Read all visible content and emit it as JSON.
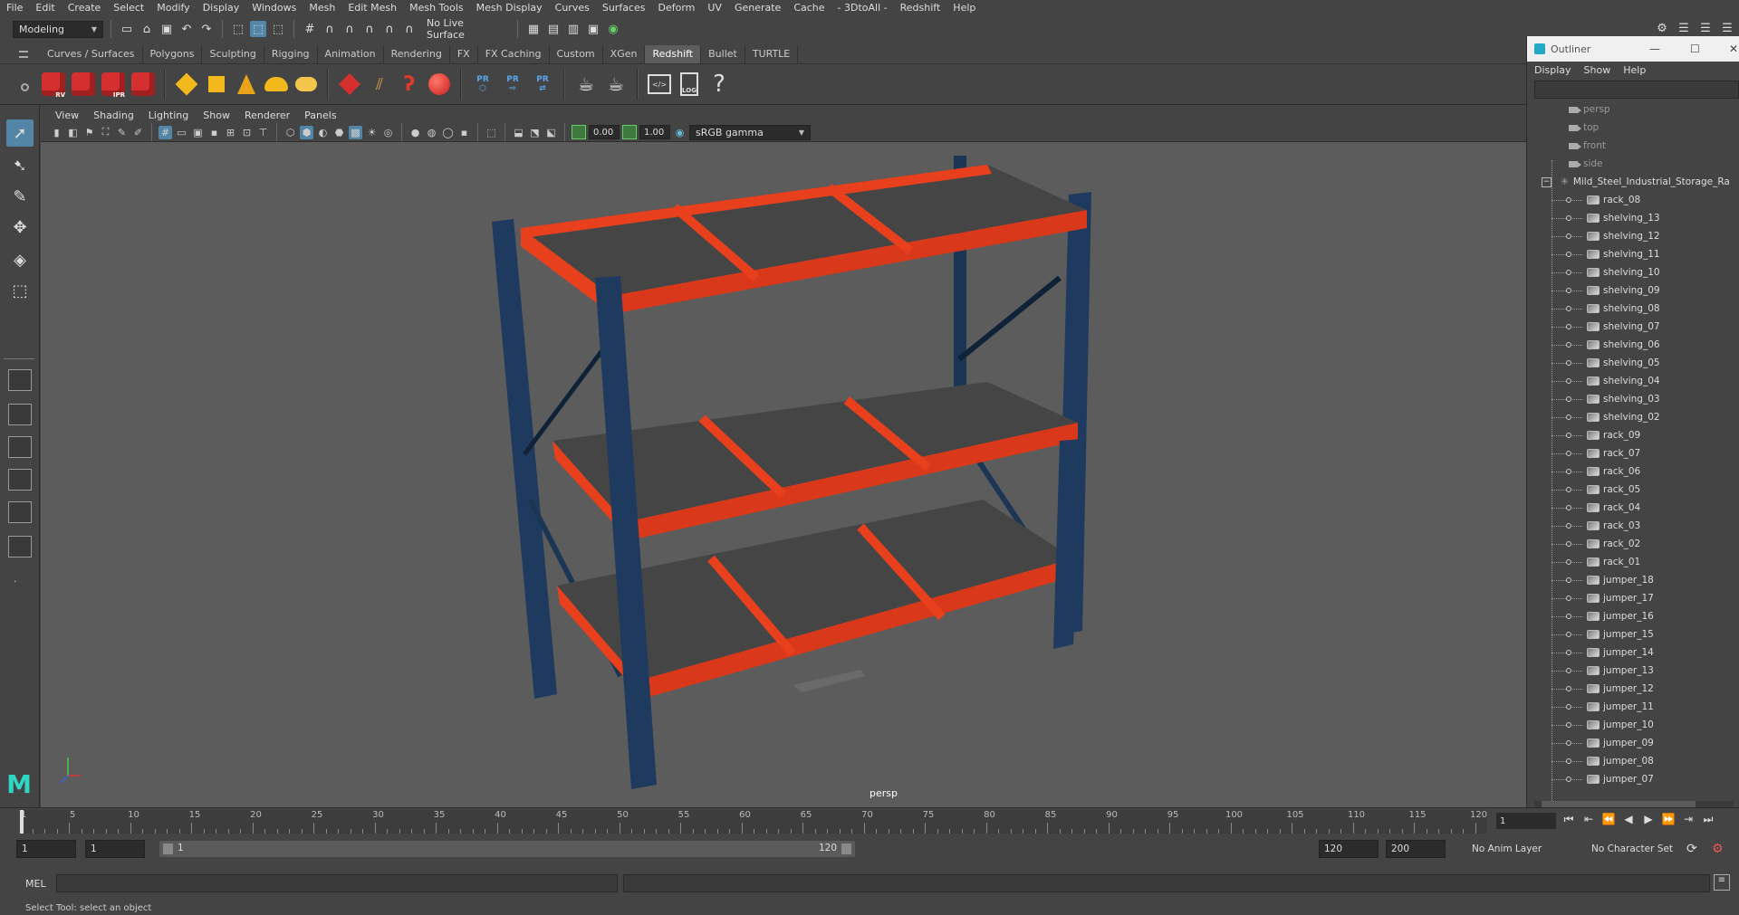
{
  "menubar": [
    "File",
    "Edit",
    "Create",
    "Select",
    "Modify",
    "Display",
    "Windows",
    "Mesh",
    "Edit Mesh",
    "Mesh Tools",
    "Mesh Display",
    "Curves",
    "Surfaces",
    "Deform",
    "UV",
    "Generate",
    "Cache",
    "- 3DtoAll -",
    "Redshift",
    "Help"
  ],
  "statusline": {
    "mode": "Modeling",
    "live_surface": "No Live Surface"
  },
  "shelf_tabs": [
    "Curves / Surfaces",
    "Polygons",
    "Sculpting",
    "Rigging",
    "Animation",
    "Rendering",
    "FX",
    "FX Caching",
    "Custom",
    "XGen",
    "Redshift",
    "Bullet",
    "TURTLE"
  ],
  "active_shelf_tab": "Redshift",
  "shelf_labels": {
    "rv": "RV",
    "ipr": "IPR",
    "pr": "PR",
    "log": "LOG",
    "help": "?"
  },
  "panel_menu": [
    "View",
    "Shading",
    "Lighting",
    "Show",
    "Renderer",
    "Panels"
  ],
  "panel_toolbar": {
    "exposure": "0.00",
    "gamma": "1.00",
    "color_space": "sRGB gamma"
  },
  "viewport": {
    "camera_label": "persp"
  },
  "outliner": {
    "title": "Outliner",
    "menu": [
      "Display",
      "Show",
      "Help"
    ],
    "cameras": [
      "persp",
      "top",
      "front",
      "side"
    ],
    "root": "Mild_Steel_Industrial_Storage_Ra",
    "children": [
      "rack_08",
      "shelving_13",
      "shelving_12",
      "shelving_11",
      "shelving_10",
      "shelving_09",
      "shelving_08",
      "shelving_07",
      "shelving_06",
      "shelving_05",
      "shelving_04",
      "shelving_03",
      "shelving_02",
      "rack_09",
      "rack_07",
      "rack_06",
      "rack_05",
      "rack_04",
      "rack_03",
      "rack_02",
      "rack_01",
      "jumper_18",
      "jumper_17",
      "jumper_16",
      "jumper_15",
      "jumper_14",
      "jumper_13",
      "jumper_12",
      "jumper_11",
      "jumper_10",
      "jumper_09",
      "jumper_08",
      "jumper_07"
    ]
  },
  "timeslider": {
    "ticks": [
      "1",
      "5",
      "10",
      "15",
      "20",
      "25",
      "30",
      "35",
      "40",
      "45",
      "50",
      "55",
      "60",
      "65",
      "70",
      "75",
      "80",
      "85",
      "90",
      "95",
      "100",
      "105",
      "110",
      "115",
      "120"
    ],
    "current_frame": "1"
  },
  "range": {
    "start": "1",
    "inner_start": "1",
    "range_start_label": "1",
    "range_end_label": "120",
    "end": "120",
    "max_end": "200",
    "anim_layer": "No Anim Layer",
    "character_set": "No Character Set"
  },
  "cmdline": {
    "label": "MEL"
  },
  "help_line": "Select Tool: select an object",
  "colors": {
    "shelf_frame": "#e8401c",
    "upright": "#1e3a5f",
    "deck": "#3d3d3d",
    "active_tab": "#5d5d5d",
    "highlight": "#5285a6"
  }
}
